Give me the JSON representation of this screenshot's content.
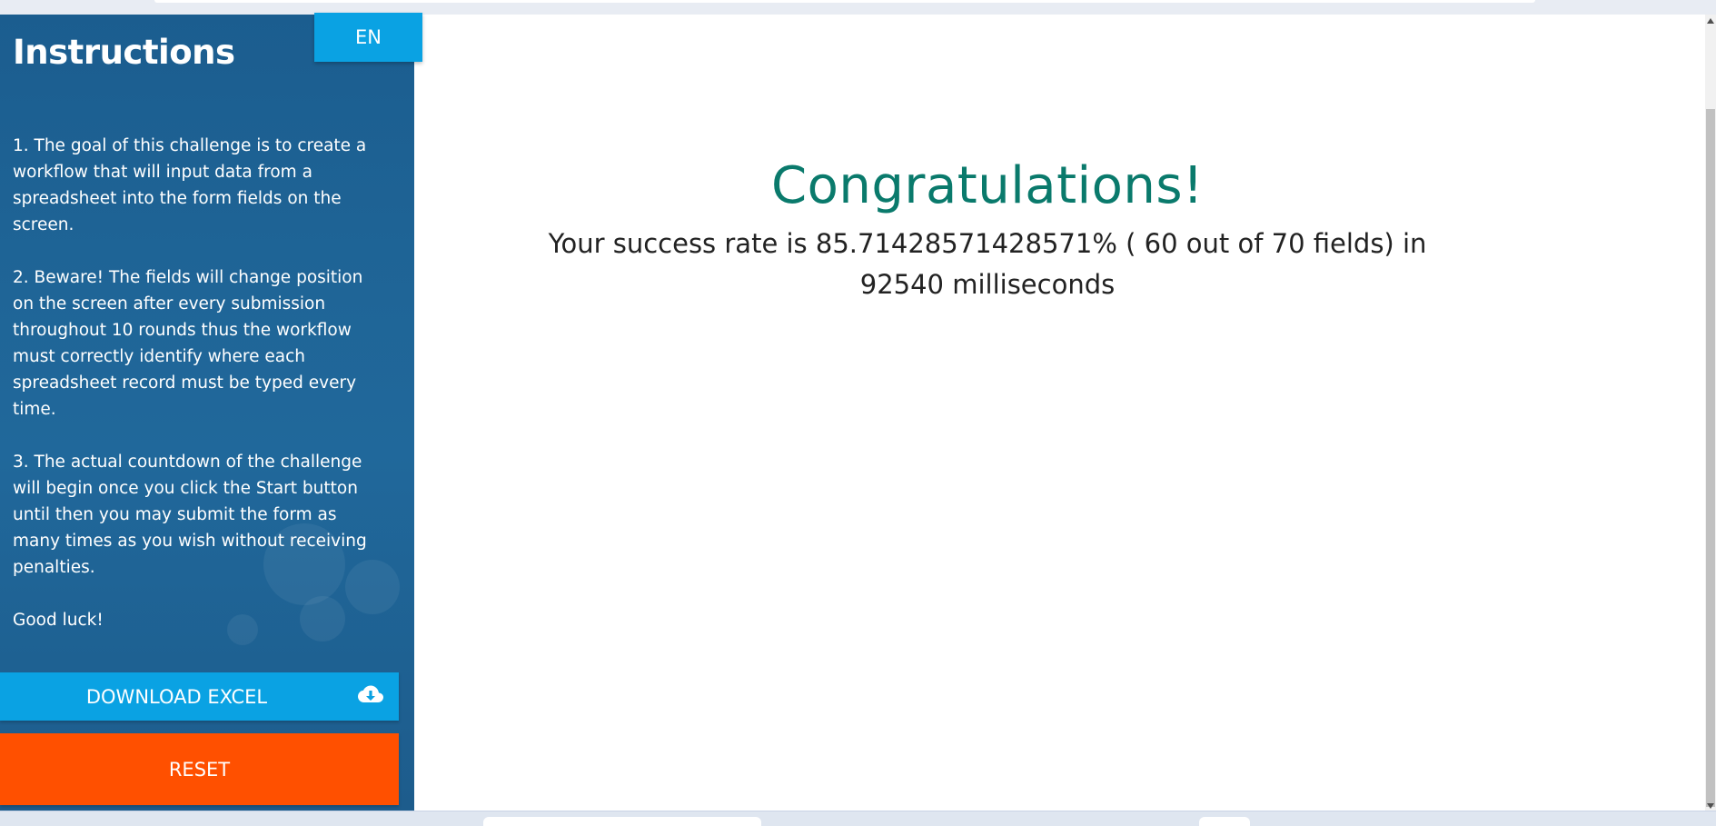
{
  "sidebar": {
    "title": "Instructions",
    "language_button": "EN",
    "instructions": [
      "1. The goal of this challenge is to create a workflow that will input data from a spreadsheet into the form fields on the screen.",
      "2. Beware! The fields will change position on the screen after every submission throughout 10 rounds thus the workflow must correctly identify where each spreadsheet record must be typed every time.",
      "3. The actual countdown of the challenge will begin once you click the Start button until then you may submit the form as many times as you wish without receiving penalties.",
      "Good luck!"
    ],
    "download_label": "DOWNLOAD EXCEL",
    "download_icon": "cloud-download-icon",
    "reset_label": "RESET"
  },
  "main": {
    "heading": "Congratulations!",
    "result_text": "Your success rate is 85.71428571428571% ( 60 out of 70 fields) in 92540 milliseconds"
  },
  "colors": {
    "sidebar_bg": "#1f6597",
    "accent_blue": "#0aa2e3",
    "reset_orange": "#ff5000",
    "heading_teal": "#0a7a6c"
  }
}
